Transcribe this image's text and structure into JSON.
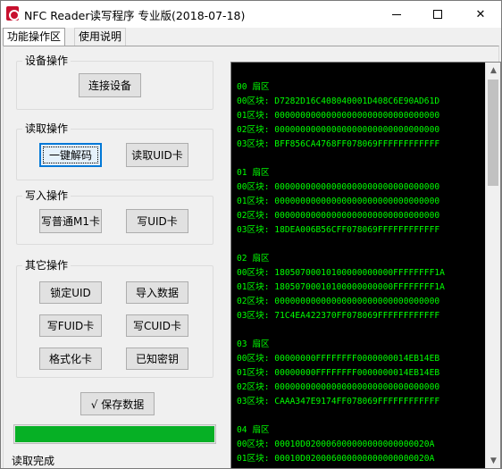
{
  "window": {
    "title": "NFC Reader读写程序 专业版(2018-07-18)",
    "close_glyph": "✕"
  },
  "tabs": [
    {
      "label": "功能操作区",
      "active": true
    },
    {
      "label": "使用说明",
      "active": false
    }
  ],
  "groups": {
    "device": {
      "title": "设备操作",
      "connect_label": "连接设备"
    },
    "read": {
      "title": "读取操作",
      "decode_label": "一键解码",
      "read_uid_label": "读取UID卡"
    },
    "write": {
      "title": "写入操作",
      "write_m1_label": "写普通M1卡",
      "write_uid_label": "写UID卡"
    },
    "other": {
      "title": "其它操作",
      "lock_uid_label": "锁定UID",
      "import_label": "导入数据",
      "write_fuid_label": "写FUID卡",
      "write_cuid_label": "写CUID卡",
      "format_label": "格式化卡",
      "known_keys_label": "已知密钥"
    }
  },
  "save_label": "√ 保存数据",
  "progress": {
    "percent": 100,
    "color": "#06b025"
  },
  "status": "读取完成",
  "console": {
    "text_color": "#00ff00",
    "background": "#000000",
    "lines": [
      "00 扇区",
      "00区块: D7282D16C408040001D408C6E90AD61D",
      "01区块: 00000000000000000000000000000000",
      "02区块: 00000000000000000000000000000000",
      "03区块: BFF856CA4768FF078069FFFFFFFFFFFF",
      "",
      "01 扇区",
      "00区块: 00000000000000000000000000000000",
      "01区块: 00000000000000000000000000000000",
      "02区块: 00000000000000000000000000000000",
      "03区块: 18DEA006B56CFF078069FFFFFFFFFFFF",
      "",
      "02 扇区",
      "00区块: 18050700010100000000000FFFFFFFF1A",
      "01区块: 18050700010100000000000FFFFFFFF1A",
      "02区块: 00000000000000000000000000000000",
      "03区块: 71C4EA422370FF078069FFFFFFFFFFFF",
      "",
      "03 扇区",
      "00区块: 00000000FFFFFFFF0000000014EB14EB",
      "01区块: 00000000FFFFFFFF0000000014EB14EB",
      "02区块: 00000000000000000000000000000000",
      "03区块: CAAA347E9174FF078069FFFFFFFFFFFF",
      "",
      "04 扇区",
      "00区块: 00010D020006000000000000000020A",
      "01区块: 00010D020006000000000000000020A"
    ]
  }
}
